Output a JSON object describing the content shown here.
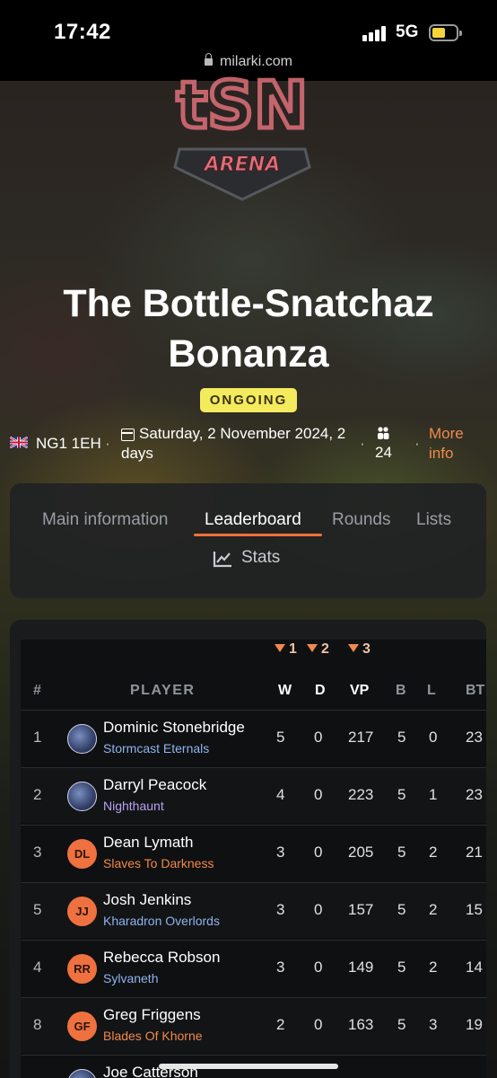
{
  "status": {
    "time": "17:42",
    "network": "5G",
    "url": "milarki.com"
  },
  "event": {
    "title": "The Bottle-Snatchaz Bonanza",
    "status_badge": "ONGOING",
    "postcode": "NG1 1EH",
    "date": "Saturday, 2 November 2024, 2 days",
    "players": "24",
    "more_info": "More info"
  },
  "logo": {
    "top": "tSN",
    "bottom": "ARENA"
  },
  "tabs": [
    {
      "label": "Main information",
      "active": false
    },
    {
      "label": "Leaderboard",
      "active": true
    },
    {
      "label": "Rounds",
      "active": false
    },
    {
      "label": "Lists",
      "active": false
    },
    {
      "label": "Stats",
      "active": false
    }
  ],
  "leaderboard": {
    "rank_indicators": [
      "1",
      "2",
      "3"
    ],
    "columns": [
      "#",
      "PLAYER",
      "W",
      "D",
      "VP",
      "B",
      "L",
      "BT"
    ],
    "rows": [
      {
        "rank": "1",
        "initials": "",
        "name": "Dominic Stonebridge",
        "faction": "Stormcast Eternals",
        "faction_color": "blue",
        "w": "5",
        "d": "0",
        "vp": "217",
        "b": "5",
        "l": "0",
        "bt": "23"
      },
      {
        "rank": "2",
        "initials": "",
        "name": "Darryl Peacock",
        "faction": "Nighthaunt",
        "faction_color": "purple",
        "w": "4",
        "d": "0",
        "vp": "223",
        "b": "5",
        "l": "1",
        "bt": "23"
      },
      {
        "rank": "3",
        "initials": "DL",
        "name": "Dean Lymath",
        "faction": "Slaves To Darkness",
        "faction_color": "orange",
        "w": "3",
        "d": "0",
        "vp": "205",
        "b": "5",
        "l": "2",
        "bt": "21"
      },
      {
        "rank": "5",
        "initials": "JJ",
        "name": "Josh Jenkins",
        "faction": "Kharadron Overlords",
        "faction_color": "blue",
        "w": "3",
        "d": "0",
        "vp": "157",
        "b": "5",
        "l": "2",
        "bt": "15"
      },
      {
        "rank": "4",
        "initials": "RR",
        "name": "Rebecca Robson",
        "faction": "Sylvaneth",
        "faction_color": "blue",
        "w": "3",
        "d": "0",
        "vp": "149",
        "b": "5",
        "l": "2",
        "bt": "14"
      },
      {
        "rank": "8",
        "initials": "GF",
        "name": "Greg Friggens",
        "faction": "Blades Of Khorne",
        "faction_color": "orange",
        "w": "2",
        "d": "0",
        "vp": "163",
        "b": "5",
        "l": "3",
        "bt": "19"
      },
      {
        "rank": "",
        "initials": "",
        "name": "Joe Catterson",
        "faction": "",
        "faction_color": "blue",
        "w": "",
        "d": "",
        "vp": "",
        "b": "",
        "l": "",
        "bt": ""
      }
    ]
  },
  "colors": {
    "accent": "#f26f3a",
    "badge": "#f4ea5e",
    "link": "#f08a4b"
  }
}
